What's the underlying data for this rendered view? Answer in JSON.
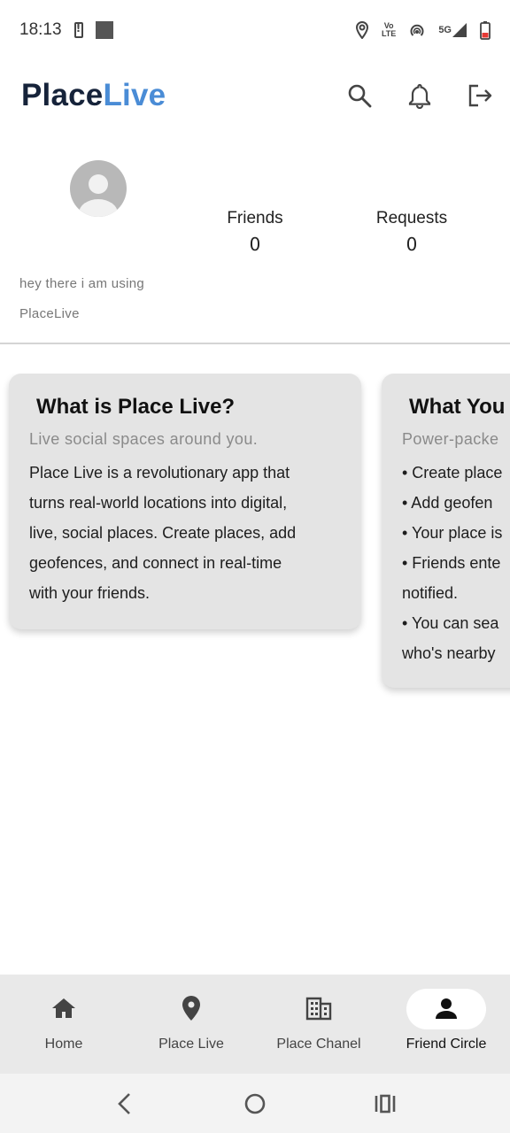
{
  "status_bar": {
    "time": "18:13",
    "network": "5G",
    "volte_line1": "Vo",
    "volte_line2": "LTE",
    "icons": [
      "battery-alert-icon",
      "notification-square-icon",
      "location-icon",
      "volte-icon",
      "hotspot-icon",
      "signal-icon",
      "battery-low-icon"
    ]
  },
  "header": {
    "logo_part1": "Place",
    "logo_part2": "Live",
    "colors": {
      "logo_dark": "#16233a",
      "logo_accent": "#4a8cd6"
    },
    "actions": [
      "search-icon",
      "bell-icon",
      "logout-icon"
    ]
  },
  "profile": {
    "stats": [
      {
        "label": "Friends",
        "value": "0"
      },
      {
        "label": "Requests",
        "value": "0"
      }
    ],
    "bio_line1": "hey there i am using",
    "bio_line2": "PlaceLive"
  },
  "cards": [
    {
      "title": "What is Place Live?",
      "subtitle": "Live social spaces around you.",
      "body_lines": [
        "Place Live is a revolutionary app that",
        "turns real-world locations into digital,",
        "live, social places. Create places, add",
        "geofences, and connect in real-time",
        "with your friends."
      ]
    },
    {
      "title": "What You",
      "subtitle": "Power-packe",
      "body_lines": [
        "• Create place",
        "• Add geofen",
        "• Your place is",
        "• Friends ente",
        "notified.",
        "• You can sea",
        "who's nearby"
      ]
    }
  ],
  "bottom_nav": {
    "items": [
      {
        "label": "Home",
        "icon": "home-icon",
        "active": false
      },
      {
        "label": "Place Live",
        "icon": "location-pin-icon",
        "active": false
      },
      {
        "label": "Place Chanel",
        "icon": "building-icon",
        "active": false
      },
      {
        "label": "Friend Circle",
        "icon": "person-icon",
        "active": true
      }
    ]
  },
  "system_nav": [
    "back-icon",
    "home-circle-icon",
    "recents-icon"
  ]
}
